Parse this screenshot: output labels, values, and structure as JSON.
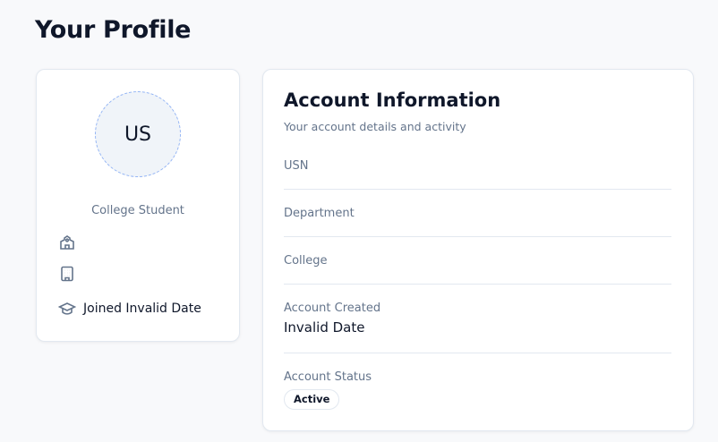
{
  "page_title": "Your Profile",
  "profile": {
    "initials": "US",
    "role": "College Student",
    "joined": "Joined Invalid Date"
  },
  "account": {
    "title": "Account Information",
    "subtitle": "Your account details and activity",
    "fields": [
      {
        "label": "USN"
      },
      {
        "label": "Department"
      },
      {
        "label": "College"
      },
      {
        "label": "Account Created",
        "value": "Invalid Date"
      },
      {
        "label": "Account Status",
        "value": "Active"
      }
    ]
  }
}
